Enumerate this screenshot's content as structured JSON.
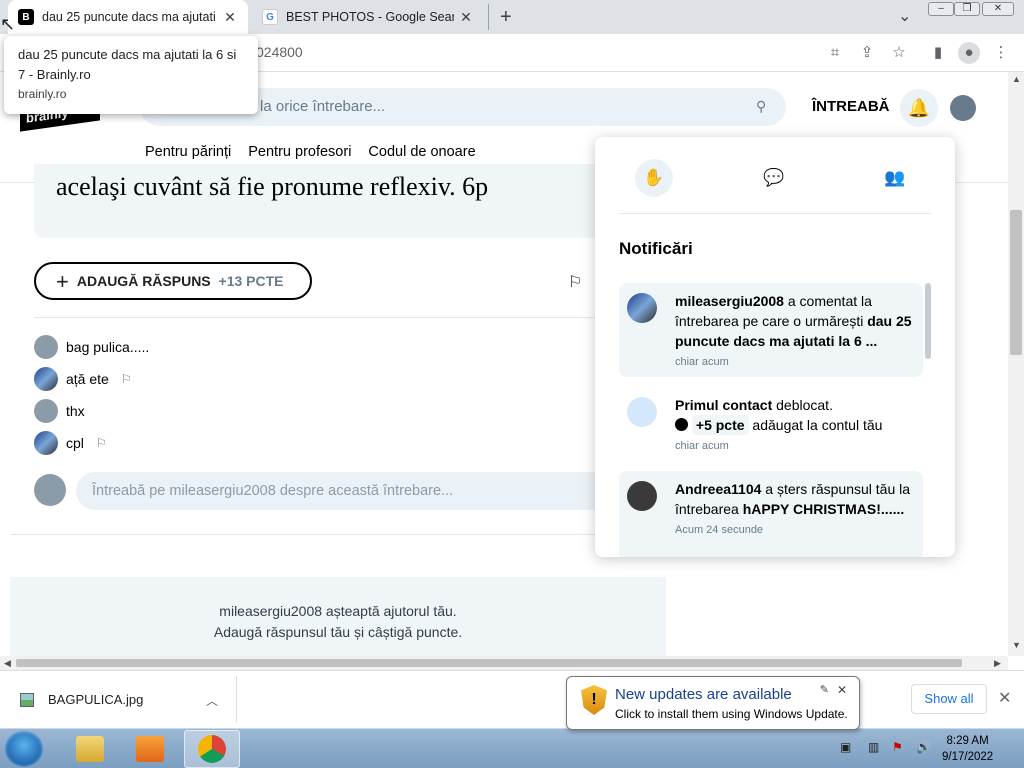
{
  "browser": {
    "tabs": [
      {
        "title": "dau 25 puncute dacs ma ajutati la 6 si 7 - Brainly.ro",
        "favicon": "brainly-icon",
        "active": true
      },
      {
        "title": "BEST PHOTOS - Google Search",
        "favicon": "google-icon",
        "active": false
      }
    ],
    "new_tab": "+",
    "tab_search": "⌄",
    "address_fragment": "024800",
    "tooltip": {
      "title": "dau 25 puncute dacs ma ajutati la 6 si 7 - Brainly.ro",
      "domain": "brainly.ro"
    }
  },
  "site": {
    "logo": "brainly",
    "search_placeholder": "ns la orice întrebare...",
    "ask_label": "ÎNTREABĂ",
    "subnav": [
      "Pentru părinți",
      "Pentru profesori",
      "Codul de onoare"
    ]
  },
  "question": {
    "text_fragment": "acelaşi cuvânt să fie pronume reflexiv. 6p",
    "add_answer_label": "ADAUGĂ RĂSPUNS",
    "add_answer_points": "+13 PCTE"
  },
  "comments": [
    {
      "text": "bag pulica.....",
      "has_flag": false,
      "avatar": "default"
    },
    {
      "text": "ață ete",
      "has_flag": true,
      "avatar": "image"
    },
    {
      "text": "thx",
      "has_flag": false,
      "avatar": "default"
    },
    {
      "text": "cpl",
      "has_flag": true,
      "avatar": "image"
    }
  ],
  "comment_input_placeholder": "Întreabă pe mileasergiu2008 despre această întrebare...",
  "waiting": {
    "line1": "mileasergiu2008 așteaptă ajutorul tău.",
    "line2": "Adaugă răspunsul tău și câștigă puncte."
  },
  "notifications": {
    "title": "Notificări",
    "items": [
      {
        "user": "mileasergiu2008",
        "text": " a comentat la întrebarea pe care o urmărești ",
        "bold_tail": "dau 25 puncute dacs ma ajutati la 6 ...",
        "time": "chiar acum",
        "unread": true
      },
      {
        "user": "Primul contact",
        "text": " deblocat.",
        "points": "+5 pcte",
        "points_tail": " adăugat la contul tău",
        "time": "chiar acum",
        "unread": false
      },
      {
        "user": "Andreea1104",
        "text": " a șters răspunsul tău la întrebarea ",
        "bold_tail": "hAPPY CHRISTMAS!......",
        "time": "Acum 24 secunde",
        "unread": true
      }
    ]
  },
  "downloads": {
    "file": "BAGPULICA.jpg",
    "show_all": "Show all"
  },
  "balloon": {
    "title": "New updates are available",
    "subtitle": "Click to install them using Windows Update."
  },
  "taskbar": {
    "time": "8:29 AM",
    "date": "9/17/2022"
  },
  "colors": {
    "brainly_light": "#ebf2f7",
    "text_gray": "#687b8c",
    "chrome_blue": "#1a73e8"
  }
}
